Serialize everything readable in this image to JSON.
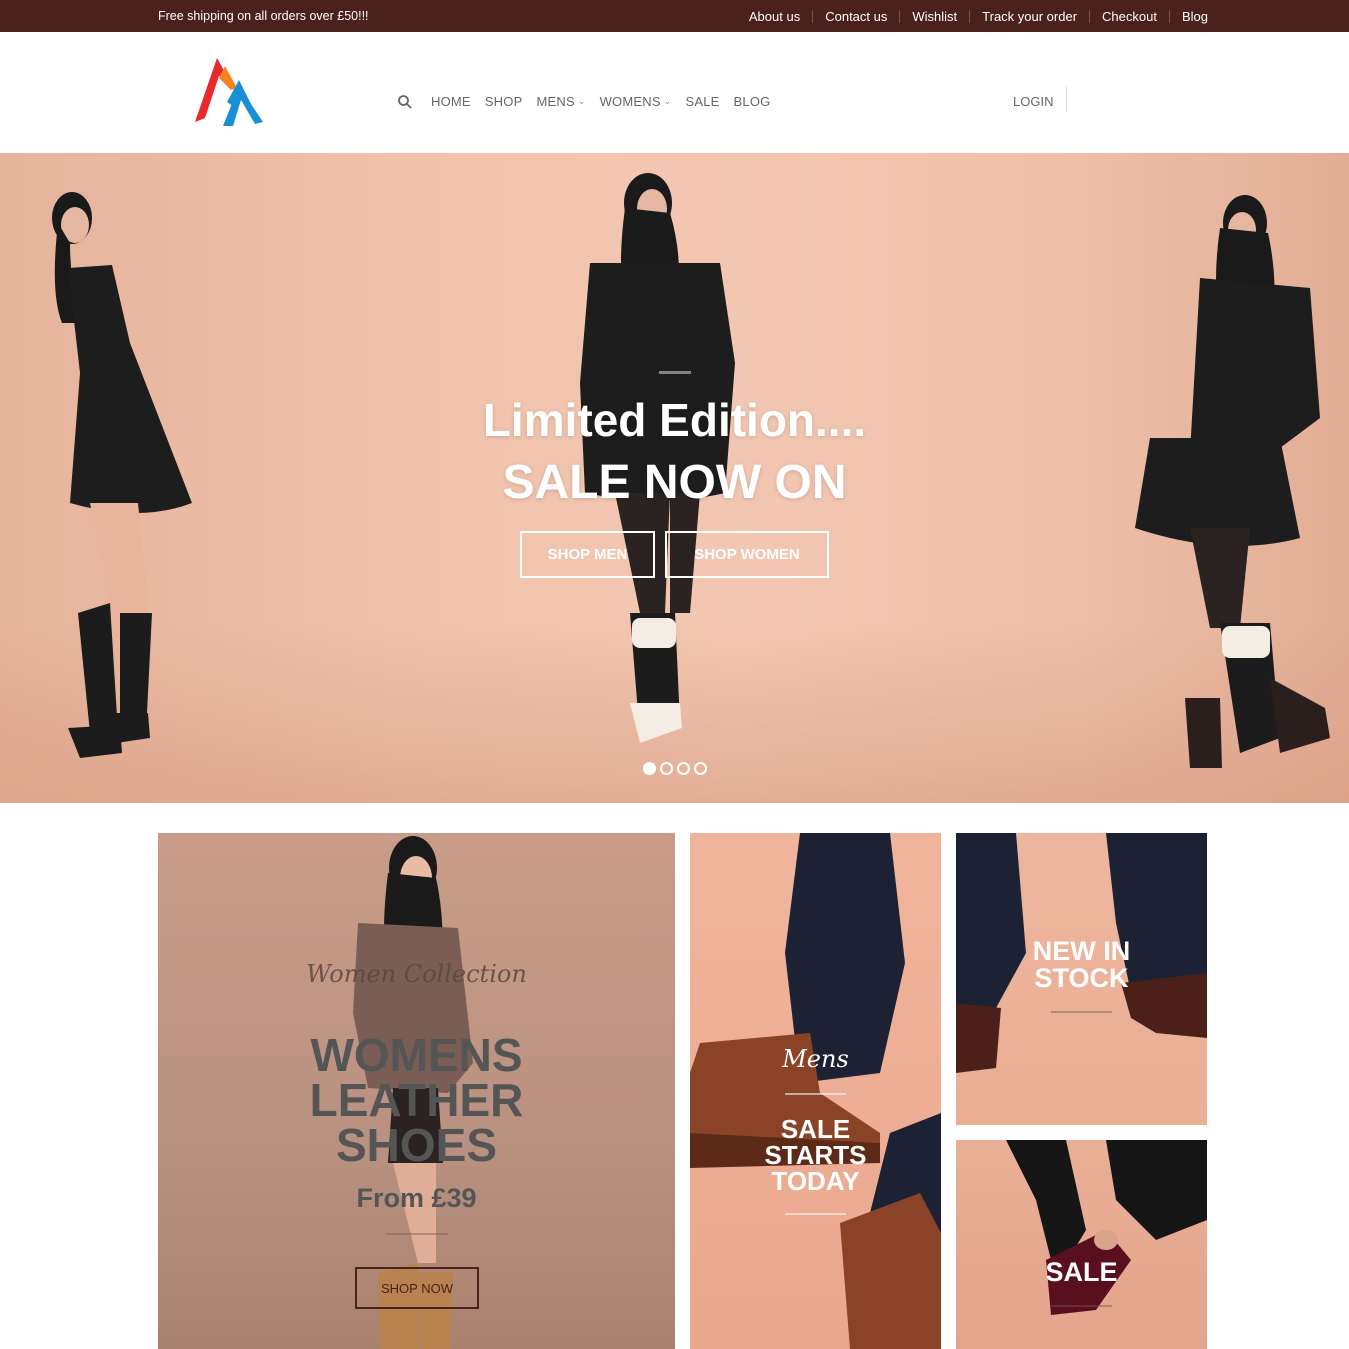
{
  "topbar": {
    "promo": "Free shipping on all orders over £50!!!",
    "links": [
      "About us",
      "Contact us",
      "Wishlist",
      "Track your order",
      "Checkout",
      "Blog"
    ]
  },
  "header": {
    "nav": {
      "home": "HOME",
      "shop": "SHOP",
      "mens": "MENS",
      "womens": "WOMENS",
      "sale": "SALE",
      "blog": "BLOG"
    },
    "login": "LOGIN"
  },
  "hero": {
    "title_line1": "Limited Edition....",
    "title_line2": "SALE NOW ON",
    "button_men": "SHOP MEN",
    "button_women": "SHOP WOMEN",
    "slides_count": 4,
    "active_slide": 1
  },
  "tiles": {
    "womens": {
      "script": "Women Collection",
      "title_lines": [
        "WOMENS",
        "LEATHER",
        "SHOES"
      ],
      "price": "From £39",
      "button": "SHOP NOW"
    },
    "mens": {
      "script": "Mens",
      "title_lines": [
        "SALE",
        "STARTS",
        "TODAY"
      ]
    },
    "new_in": {
      "title_lines": [
        "NEW IN",
        "STOCK"
      ]
    },
    "sale": {
      "title": "SALE"
    }
  },
  "colors": {
    "topbar_bg": "#4a211b",
    "hero_bg": "#f0c2ab",
    "logo_red": "#e8292e",
    "logo_blue": "#1a8fd6",
    "logo_orange": "#f5821f"
  }
}
